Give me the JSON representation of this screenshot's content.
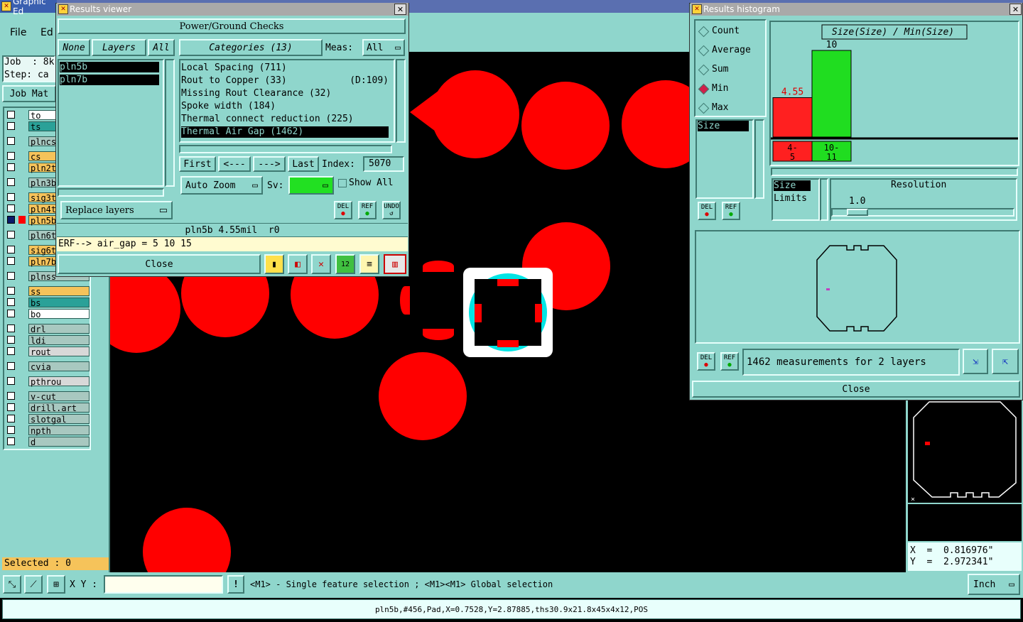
{
  "main_window": {
    "title": "Graphic Ed",
    "menu": {
      "file": "File",
      "edit": "Ed"
    },
    "job_label": "Job  : 8k",
    "step_label": "Step: ca",
    "job_matrix": "Job Mat",
    "layers": [
      {
        "name": "to",
        "color": "#ffffff"
      },
      {
        "name": "ts",
        "color": "#2aa198"
      },
      {
        "name": "plncs",
        "color": "#a8c8c0"
      },
      {
        "name": "cs",
        "color": "#f6c35a"
      },
      {
        "name": "pln2t",
        "color": "#f6c35a"
      },
      {
        "name": "pln3b",
        "color": "#a8c8c0"
      },
      {
        "name": "sig3t",
        "color": "#f6c35a"
      },
      {
        "name": "pln4t",
        "color": "#f6c35a"
      },
      {
        "name": "pln5b",
        "color": "#f6c35a"
      },
      {
        "name": "pln6t",
        "color": "#a8c8c0"
      },
      {
        "name": "sig6t",
        "color": "#f6c35a"
      },
      {
        "name": "pln7b",
        "color": "#f6c35a"
      },
      {
        "name": "plnss",
        "color": "#a8c8c0"
      },
      {
        "name": "ss",
        "color": "#f6c35a"
      },
      {
        "name": "bs",
        "color": "#2aa198"
      },
      {
        "name": "bo",
        "color": "#ffffff"
      },
      {
        "name": "drl",
        "color": "#a8c8c0"
      },
      {
        "name": "ldi",
        "color": "#a8c8c0"
      },
      {
        "name": "rout",
        "color": "#d8d8d8"
      },
      {
        "name": "cvia",
        "color": "#a8c8c0"
      },
      {
        "name": "pthrou",
        "color": "#d8d8d8"
      },
      {
        "name": "v-cut",
        "color": "#a8c8c0"
      },
      {
        "name": "drill.art",
        "color": "#a8c8c0"
      },
      {
        "name": "slotgal",
        "color": "#a8c8c0"
      },
      {
        "name": "npth",
        "color": "#a8c8c0"
      },
      {
        "name": "d",
        "color": "#a8c8c0"
      }
    ],
    "selected": "Selected : 0",
    "xy_label": "X Y :",
    "hint": "<M1> - Single feature selection ; <M1><M1> Global selection",
    "units": "Inch",
    "status": "pln5b,#456,Pad,X=0.7528,Y=2.87885,ths30.9x21.8x45x4x12,POS",
    "coords": {
      "x": "X  =  0.816976\"",
      "y": "Y  =  2.972341\""
    }
  },
  "results_viewer": {
    "title": "Results viewer",
    "header": "Power/Ground Checks",
    "none_btn": "None",
    "layers_btn": "Layers",
    "all_btn": "All",
    "categories_btn": "Categories (13)",
    "meas_label": "Meas:",
    "meas_value": "All",
    "layer_list": [
      "pln5b",
      "pln7b"
    ],
    "categories": [
      {
        "label": "Local Spacing (711)",
        "extra": ""
      },
      {
        "label": "Rout to Copper (33)",
        "extra": "(D:109)"
      },
      {
        "label": "Missing Rout Clearance (32)",
        "extra": ""
      },
      {
        "label": "Spoke width (184)",
        "extra": ""
      },
      {
        "label": "Thermal connect reduction (225)",
        "extra": ""
      },
      {
        "label": "Thermal Air Gap (1462)",
        "extra": ""
      }
    ],
    "first": "First",
    "prev": "<---",
    "next": "--->",
    "last": "Last",
    "index_label": "Index:",
    "index_value": "5070",
    "auto_zoom": "Auto Zoom",
    "sv_label": "Sv:",
    "show_all": "Show All",
    "replace_layers": "Replace layers",
    "del": "DEL",
    "ref": "REF",
    "undo": "UNDO",
    "info": "pln5b 4.55mil  r0",
    "erf": "ERF--> air_gap = 5 10 15",
    "close": "Close"
  },
  "histogram": {
    "title": "Results histogram",
    "options": [
      {
        "label": "Count",
        "selected": false
      },
      {
        "label": "Average",
        "selected": false
      },
      {
        "label": "Sum",
        "selected": false
      },
      {
        "label": "Min",
        "selected": true
      },
      {
        "label": "Max",
        "selected": false
      }
    ],
    "chart_title": "Size(Size) / Min(Size)",
    "size_item": "Size",
    "limits_list": [
      "Size",
      "Limits"
    ],
    "resolution_label": "Resolution",
    "resolution_value": "1.0",
    "measurements": "1462 measurements for 2 layers",
    "close": "Close",
    "del": "DEL",
    "ref": "REF"
  },
  "chart_data": {
    "type": "bar",
    "title": "Size(Size) / Min(Size)",
    "categories": [
      "4-\n5",
      "10-\n11"
    ],
    "values": [
      4.55,
      10
    ],
    "value_labels": [
      "4.55",
      "10"
    ],
    "colors": [
      "#ff2020",
      "#20dd20"
    ],
    "ylim": [
      0,
      10
    ],
    "grid": false
  }
}
